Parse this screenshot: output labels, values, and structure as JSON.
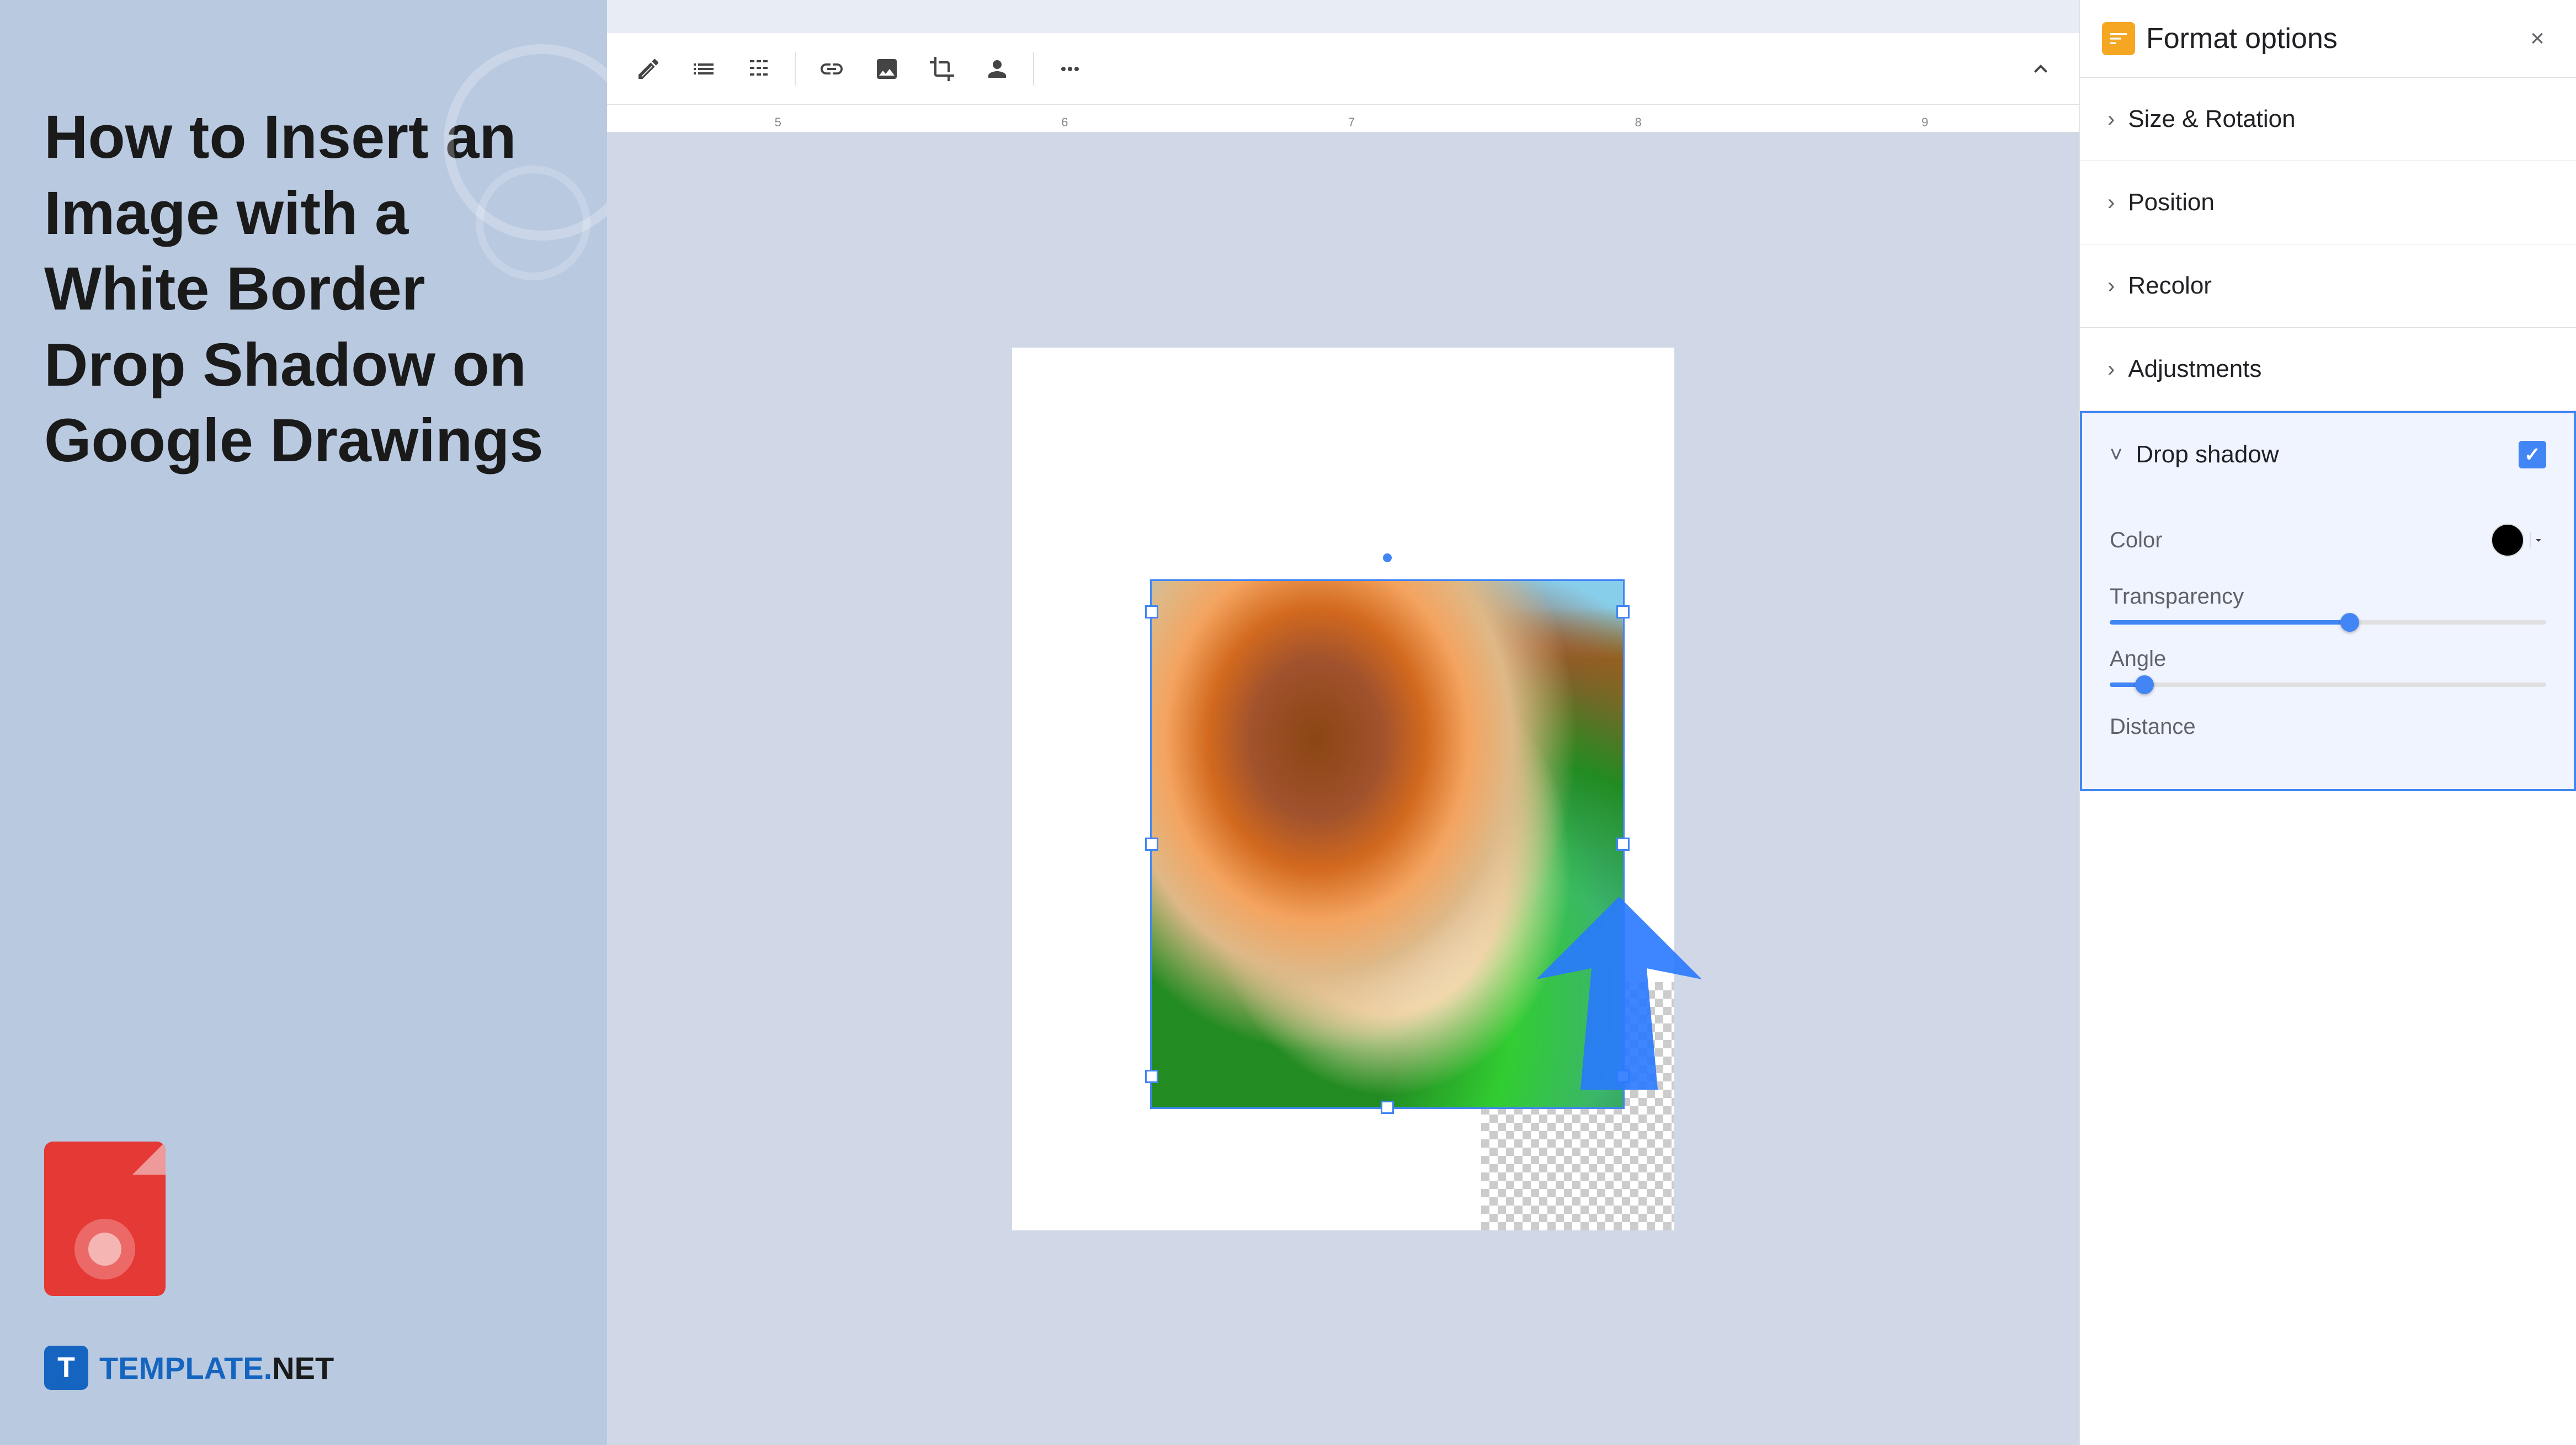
{
  "left_panel": {
    "title_line1": "How to Insert an",
    "title_line2": "Image with a",
    "title_line3": "White Border",
    "title_line4": "Drop Shadow on",
    "title_line5": "Google Drawings",
    "logo_text": "TEMPLATE",
    "logo_dot": ".",
    "logo_net": "NET"
  },
  "toolbar": {
    "icons": [
      "edit-icon",
      "list-icon",
      "grid-icon",
      "link-icon",
      "image-icon",
      "crop-icon",
      "photo-icon",
      "more-icon"
    ],
    "collapse_label": "^"
  },
  "ruler": {
    "marks": [
      "5",
      "6",
      "7",
      "8",
      "9"
    ]
  },
  "format_options": {
    "title": "Format options",
    "close_label": "×",
    "sections": [
      {
        "label": "Size & Rotation",
        "expanded": false
      },
      {
        "label": "Position",
        "expanded": false
      },
      {
        "label": "Recolor",
        "expanded": false
      },
      {
        "label": "Adjustments",
        "expanded": false
      }
    ],
    "drop_shadow": {
      "label": "Drop shadow",
      "checked": true,
      "color_label": "Color",
      "color_value": "#000000",
      "transparency_label": "Transparency",
      "transparency_value": 55,
      "angle_label": "Angle",
      "angle_value": 8,
      "distance_label": "Distance"
    }
  },
  "accent_color": "#4285f4",
  "icon_color": "#f5a623"
}
